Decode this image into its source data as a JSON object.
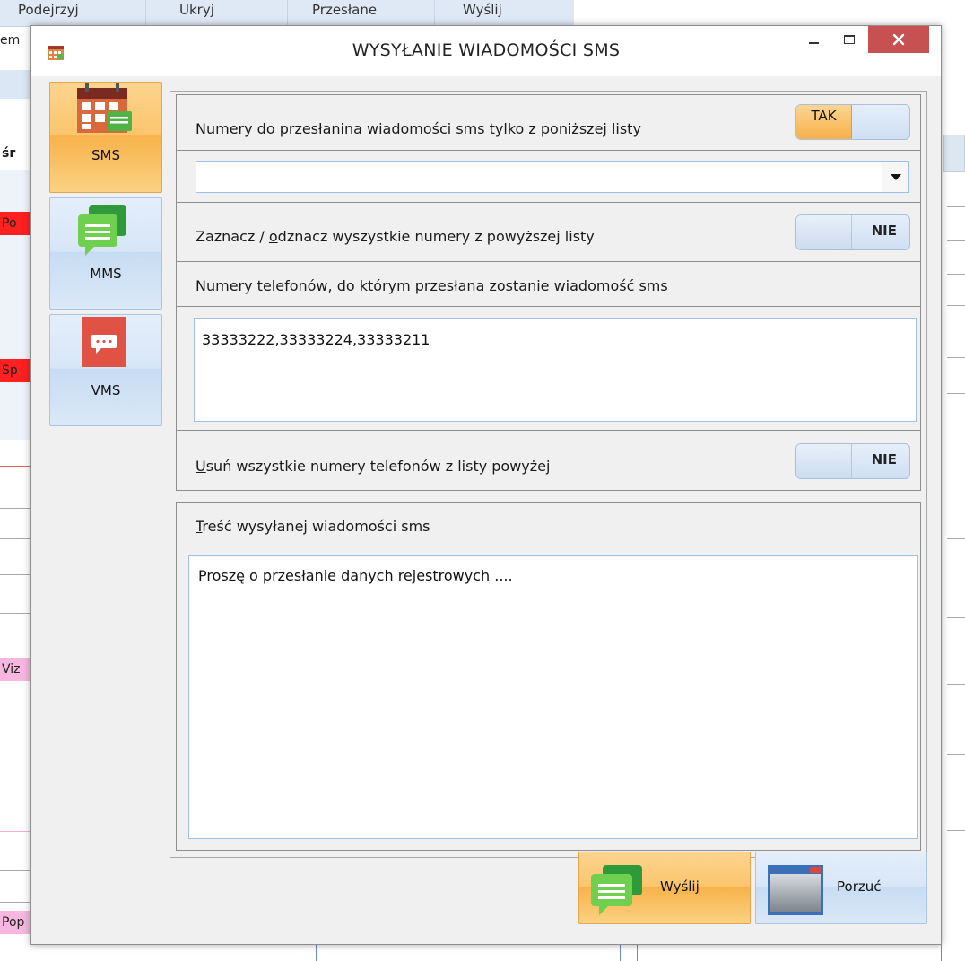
{
  "background": {
    "top_tabs": [
      "Podejrzyj",
      "Ukryj",
      "Przesłane",
      "Wyślij"
    ],
    "left_fragments": [
      "em",
      "śr",
      "Po",
      "Sp",
      "Viz",
      "Pop"
    ]
  },
  "dialog": {
    "title": "WYSYŁANIE WIADOMOŚCI SMS",
    "colors": {
      "accent": "#f8b24a",
      "close": "#c75050",
      "tile_blue": "#d7e6f7"
    },
    "nav": [
      {
        "label": "SMS",
        "icon": "calendar-sms-icon",
        "active": true
      },
      {
        "label": "MMS",
        "icon": "chat-bubbles-icon",
        "active": false
      },
      {
        "label": "VMS",
        "icon": "voice-message-icon",
        "active": false
      }
    ],
    "form": {
      "only_list": {
        "label_pre": "Numery do przesłanina ",
        "label_u": "w",
        "label_post": "iadomości sms tylko z poniższej listy",
        "toggle": "TAK"
      },
      "combo_value": "",
      "select_all": {
        "label_pre": "Zaznacz / ",
        "label_u": "o",
        "label_post": "dznacz wyszystkie numery z powyższej listy",
        "toggle": "NIE"
      },
      "numbers_label": "Numery telefonów, do którym przesłana zostanie wiadomość sms",
      "numbers_value": "33333222,33333224,33333211",
      "remove_all": {
        "label_u": "U",
        "label_post": "suń wszystkie numery telefonów z listy powyżej",
        "toggle": "NIE"
      },
      "message_label_u": "T",
      "message_label_post": "reść wysyłanej wiadomości sms",
      "message_value": "Proszę o przesłanie danych rejestrowych ...."
    },
    "buttons": {
      "send": "Wyślij",
      "abort": "Porzuć"
    }
  }
}
